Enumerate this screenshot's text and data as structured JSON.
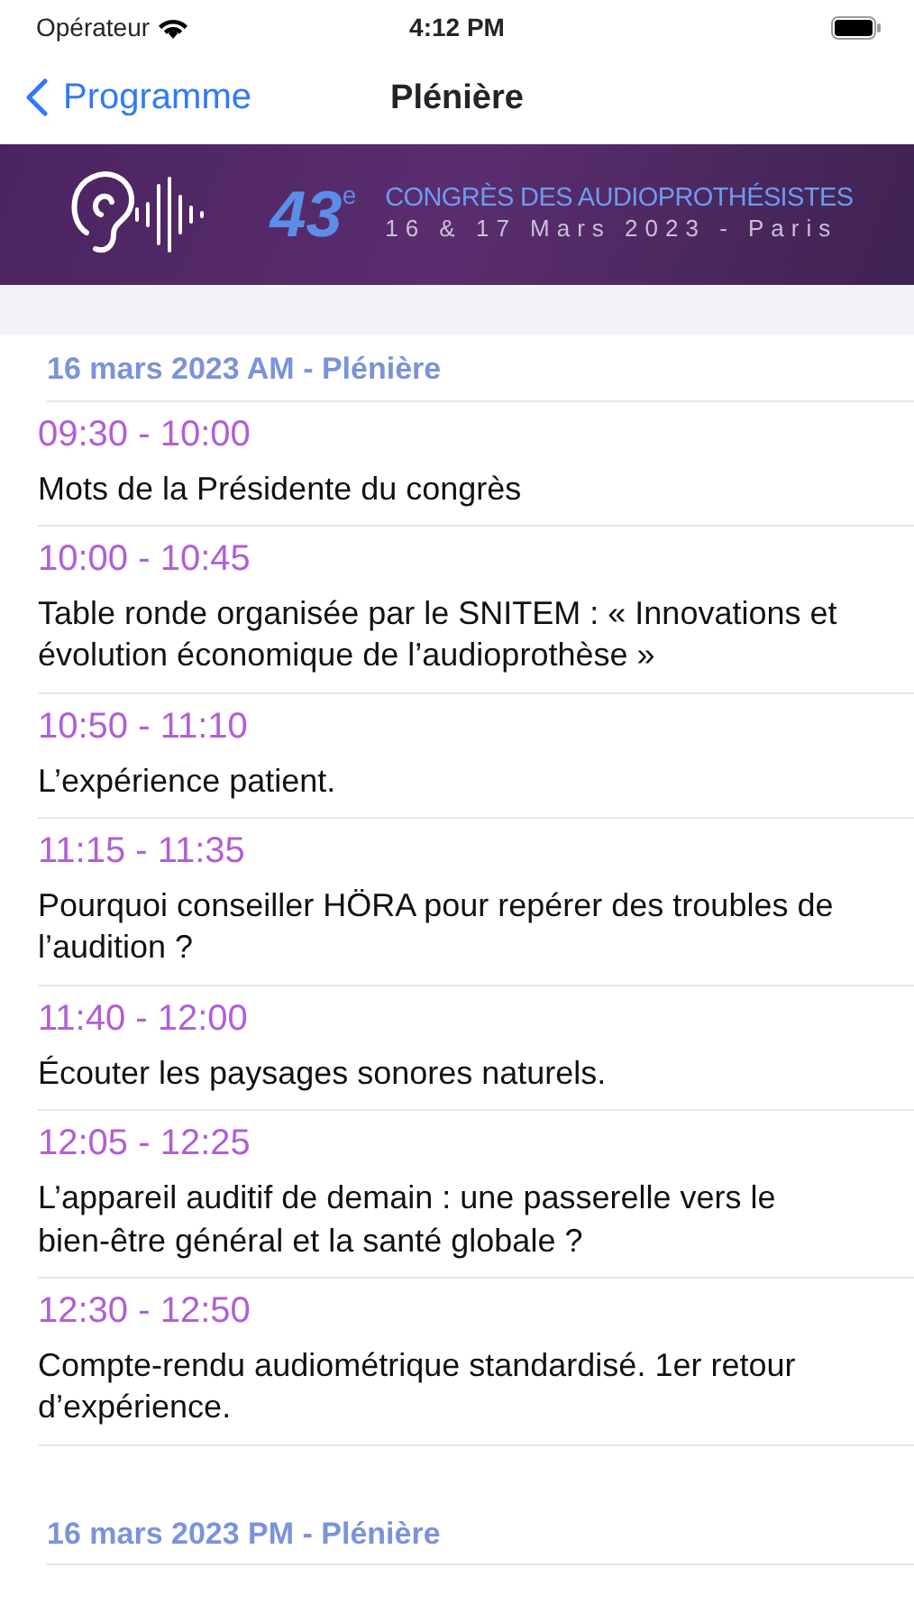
{
  "status_bar": {
    "carrier": "Opérateur",
    "time": "4:12 PM"
  },
  "nav": {
    "back": "Programme",
    "title": "Plénière"
  },
  "banner": {
    "number": "43$^{e}$",
    "title": "CONGRÈS DES AUDIOPROTHÉSISTES",
    "dates": "16 & 17 Mars 2023 - Paris"
  },
  "sections": [
    {
      "header": "16 mars 2023 AM - Plénière",
      "sessions": [
        {
          "time": "09:30 - 10:00",
          "title": "Mots de la Présidente du congrès"
        },
        {
          "time": "10:00 - 10:45",
          "title": "Table ronde organisée par le SNITEM : « Innovations et évolution économique de l’audioprothèse »"
        },
        {
          "time": "10:50 - 11:10",
          "title": "L’expérience patient."
        },
        {
          "time": "11:15 - 11:35",
          "title": "Pourquoi conseiller HÖRA pour repérer des troubles de l’audition ?"
        },
        {
          "time": "11:40 - 12:00",
          "title": "Écouter les paysages sonores naturels."
        },
        {
          "time": "12:05 - 12:25",
          "title": "L’appareil auditif de demain : une passerelle vers le bien-être général et la santé globale ?"
        },
        {
          "time": "12:30 - 12:50",
          "title": "Compte-rendu audiométrique standardisé. 1er retour d’expérience."
        }
      ]
    },
    {
      "header": "16 mars 2023 PM - Plénière"
    }
  ]
}
